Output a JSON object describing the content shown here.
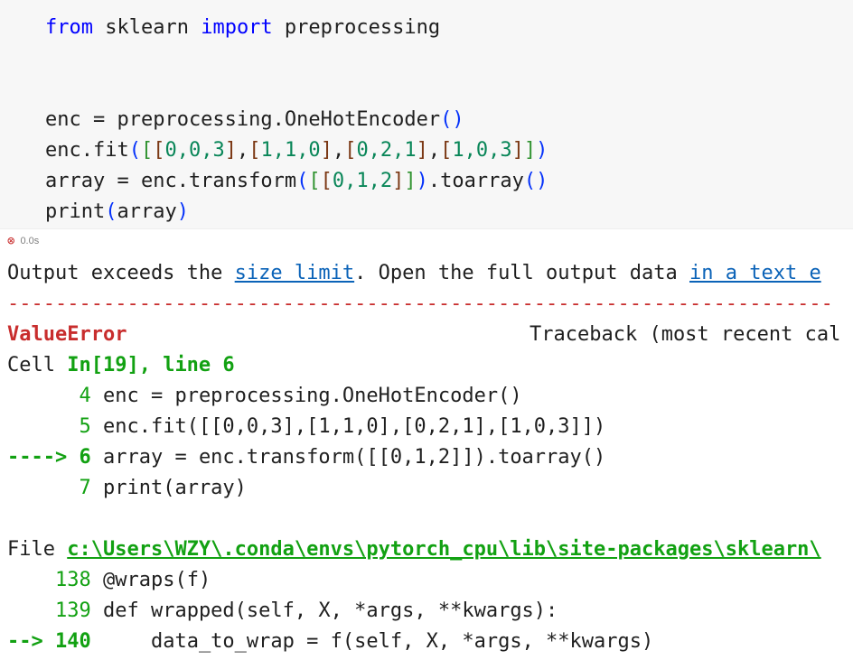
{
  "code_cell": {
    "lines": {
      "l1": {
        "kw1": "from",
        "mid": " sklearn ",
        "kw2": "import",
        "rest": " preprocessing"
      },
      "l3": {
        "a": "enc = preprocessing.OneHotEncoder",
        "o": "(",
        "c": ")"
      },
      "l4": {
        "a": "enc.fit",
        "p1": "(",
        "b1": "[",
        "b2a": "[",
        "v1": "0,0,3",
        "b2b": "]",
        "c1": ",",
        "b3a": "[",
        "v2": "1,1,0",
        "b3b": "]",
        "c2": ",",
        "b4a": "[",
        "v3": "0,2,1",
        "b4b": "]",
        "c3": ",",
        "b5a": "[",
        "v4": "1,0,3",
        "b5b": "]",
        "b1c": "]",
        "p1c": ")"
      },
      "l5": {
        "a": "array = enc.transform",
        "p1": "(",
        "b1": "[",
        "b2": "[",
        "v": "0,1,2",
        "b2c": "]",
        "b1c": "]",
        "p1c": ")",
        "mid": ".toarray",
        "p2": "(",
        "p2c": ")"
      },
      "l6": {
        "a": "print",
        "p": "(",
        "arg": "array",
        "pc": ")"
      }
    },
    "status_icon": "error-circle-icon",
    "exec_time": "0.0s"
  },
  "output": {
    "notice_pre": "Output exceeds the ",
    "notice_link1": "size limit",
    "notice_mid": ". Open the full output data ",
    "notice_link2": "in a text e",
    "separator": "---------------------------------------------------------------------",
    "error_name": "ValueError",
    "traceback_header": "Traceback (most recent cal",
    "cell_label": "Cell ",
    "cell_ref": "In[19], line 6",
    "frame1": [
      {
        "arrow": "      ",
        "num": "4",
        "code": " enc = preprocessing.OneHotEncoder()"
      },
      {
        "arrow": "      ",
        "num": "5",
        "code": " enc.fit([[0,0,3],[1,1,0],[0,2,1],[1,0,3]])"
      },
      {
        "arrow": "----> ",
        "num": "6",
        "code": " array = enc.transform([[0,1,2]]).toarray()"
      },
      {
        "arrow": "      ",
        "num": "7",
        "code": " print(array)"
      }
    ],
    "file_label": "File ",
    "file_path": "c:\\Users\\WZY\\.conda\\envs\\pytorch_cpu\\lib\\site-packages\\sklearn\\",
    "frame2": [
      {
        "arrow": "    ",
        "num": "138",
        "code": " @wraps(f)"
      },
      {
        "arrow": "    ",
        "num": "139",
        "code": " def wrapped(self, X, *args, **kwargs):"
      },
      {
        "arrow": "--> ",
        "num": "140",
        "code": "     data_to_wrap = f(self, X, *args, **kwargs)"
      }
    ]
  },
  "colors": {
    "error_red": "#c82d2d",
    "lineno_green": "#12a112",
    "link_blue": "#0b63b8",
    "cell_background": "#f7f7f7"
  }
}
